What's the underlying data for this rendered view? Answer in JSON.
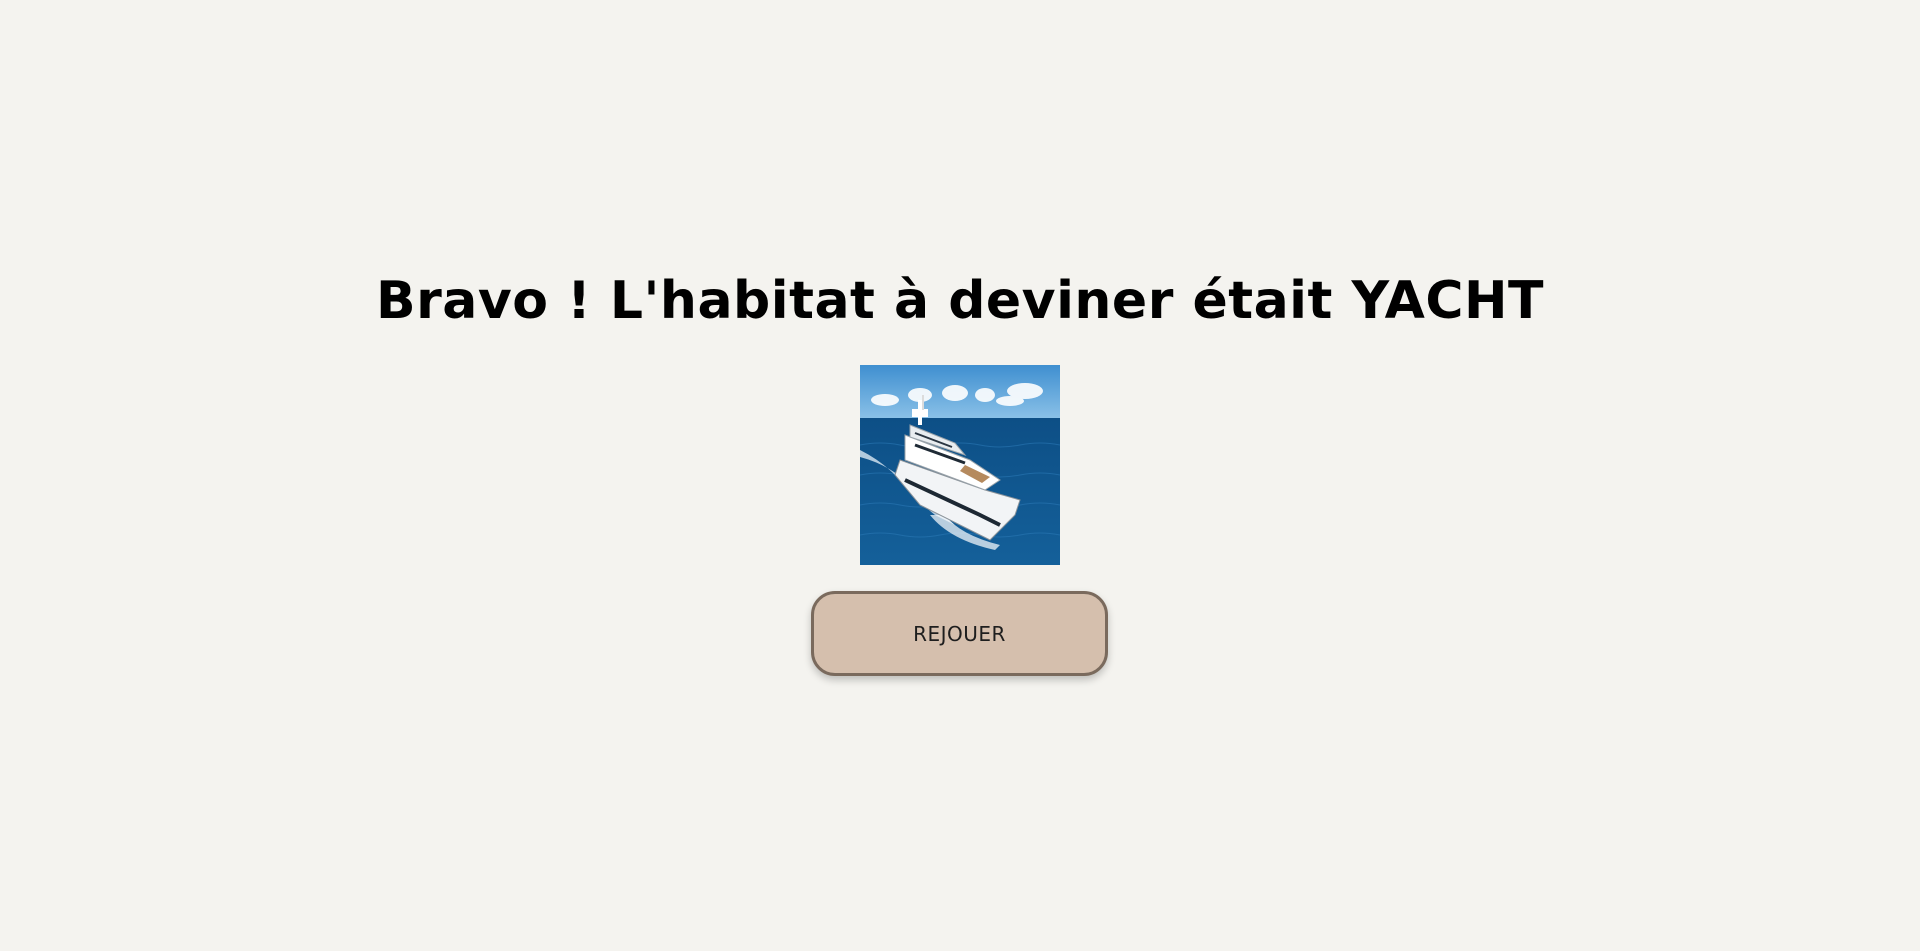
{
  "result": {
    "title": "Bravo ! L'habitat à deviner était YACHT",
    "image_subject": "yacht"
  },
  "actions": {
    "replay_label": "REJOUER"
  },
  "colors": {
    "background": "#f4f3ef",
    "title": "#000000",
    "button_fill": "#d5bfad",
    "button_border": "#7a6a5d",
    "button_text": "#1e1e1e"
  }
}
